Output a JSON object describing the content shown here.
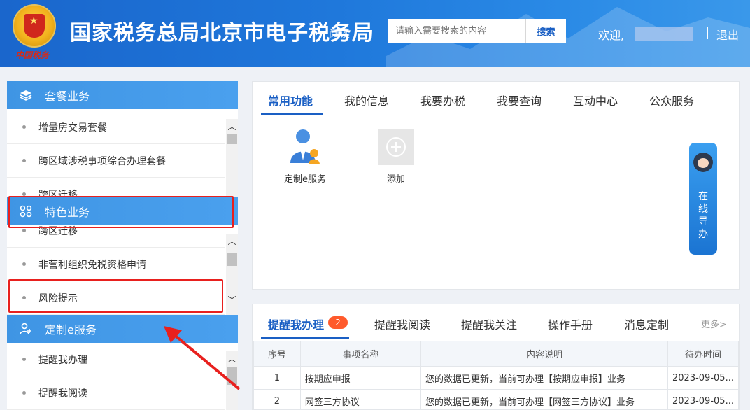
{
  "header": {
    "emblem_signature": "中国税务",
    "title": "国家税务总局北京市电子税务局",
    "read_link": "阅读",
    "search_placeholder": "请输入需要搜索的内容",
    "search_button": "搜索",
    "welcome": "欢迎,",
    "logout": "退出"
  },
  "sidebar": {
    "sections": [
      {
        "title": "套餐业务",
        "icon": "layers-icon",
        "items": [
          "增量房交易套餐",
          "跨区域涉税事项综合办理套餐",
          "跨区迁移"
        ]
      },
      {
        "title": "特色业务",
        "icon": "grid-icon",
        "items": [
          "跨区迁移",
          "非营利组织免税资格申请",
          "风险提示"
        ]
      },
      {
        "title": "定制e服务",
        "icon": "user-add-icon",
        "items": [
          "提醒我办理",
          "提醒我阅读"
        ]
      }
    ]
  },
  "main": {
    "tabs": [
      "常用功能",
      "我的信息",
      "我要办税",
      "我要查询",
      "互动中心",
      "公众服务"
    ],
    "functions": [
      {
        "label": "定制e服务",
        "icon": "person-service-icon"
      },
      {
        "label": "添加",
        "icon": "plus-circle-icon"
      }
    ],
    "online_guide": [
      "在",
      "线",
      "导",
      "办"
    ]
  },
  "reminders": {
    "tabs": [
      "提醒我办理",
      "提醒我阅读",
      "提醒我关注",
      "操作手册",
      "消息定制"
    ],
    "badge": "2",
    "more": "更多>",
    "columns": [
      "序号",
      "事项名称",
      "内容说明",
      "待办时间"
    ],
    "rows": [
      [
        "1",
        "按期应申报",
        "您的数据已更新，当前可办理【按期应申报】业务",
        "2023-09-05..."
      ],
      [
        "2",
        "网签三方协议",
        "您的数据已更新，当前可办理【网签三方协议】业务",
        "2023-09-05..."
      ]
    ]
  }
}
